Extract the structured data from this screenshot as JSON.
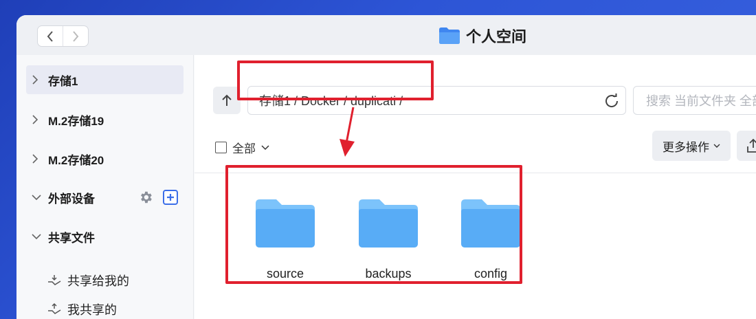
{
  "window": {
    "title": "个人空间"
  },
  "sidebar": {
    "items": [
      {
        "label": "存储1",
        "active": true
      },
      {
        "label": "M.2存储19",
        "active": false
      },
      {
        "label": "M.2存储20",
        "active": false
      },
      {
        "label": "外部设备",
        "active": false
      },
      {
        "label": "共享文件",
        "active": false
      }
    ],
    "shared_sub": [
      {
        "label": "共享给我的"
      },
      {
        "label": "我共享的"
      }
    ]
  },
  "toolbar": {
    "path": "存储1 / Docker / duplicati /",
    "search_placeholder": "搜索 当前文件夹 全部",
    "select_all_label": "全部",
    "more_label": "更多操作"
  },
  "files": [
    {
      "name": "source",
      "icon": "folder-icon"
    },
    {
      "name": "backups",
      "icon": "folder-icon"
    },
    {
      "name": "config",
      "icon": "folder-icon"
    }
  ],
  "colors": {
    "highlight": "#e0202e",
    "folder": "#5fb0f5",
    "accent": "#3b6ee8"
  }
}
